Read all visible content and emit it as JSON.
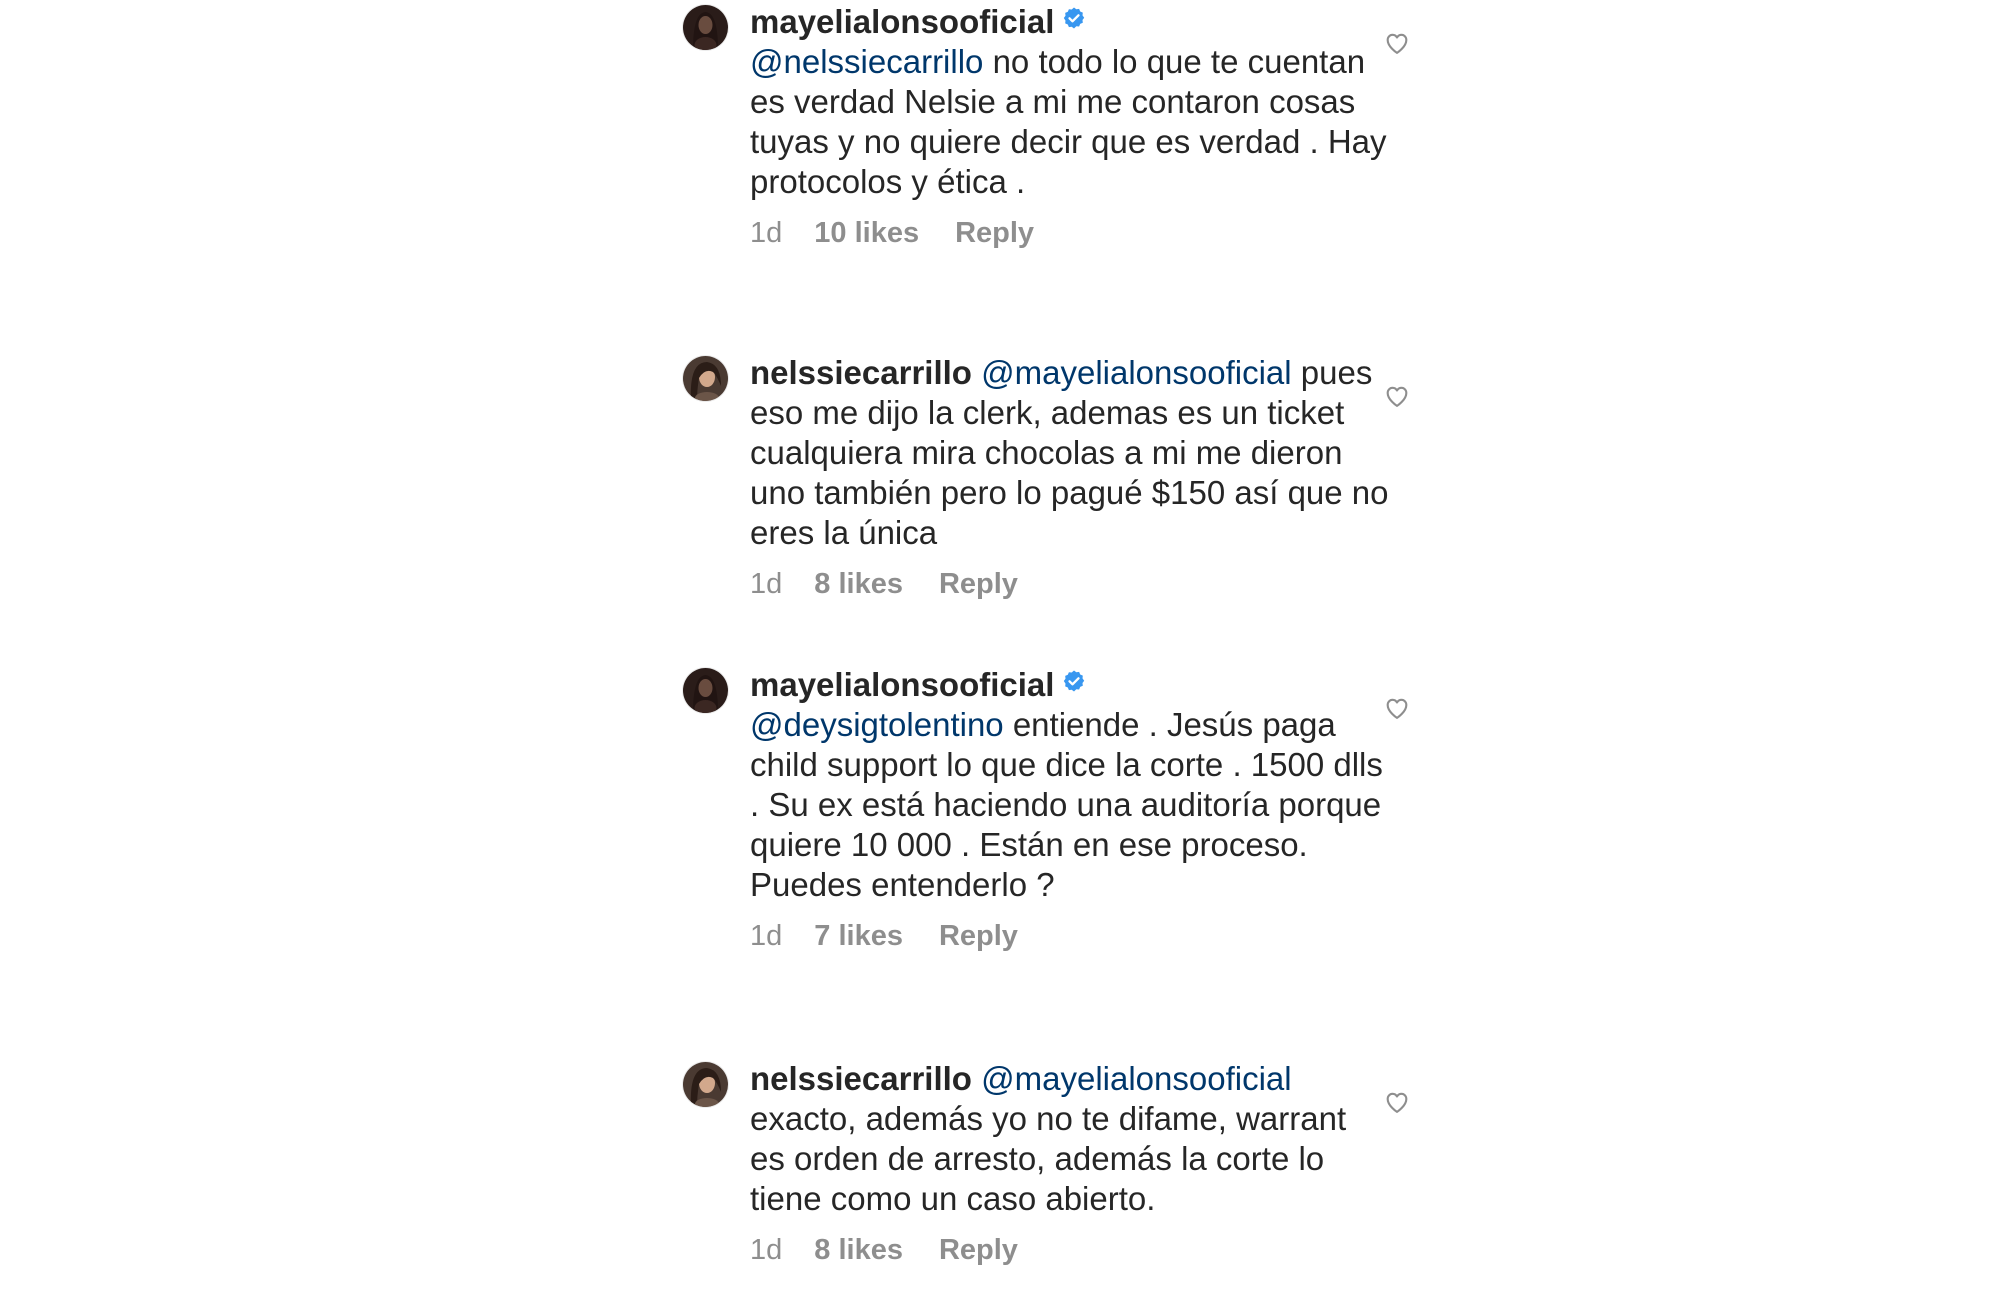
{
  "comments": [
    {
      "username": "mayelialonsooficial",
      "verified": true,
      "mention": "@nelssiecarrillo",
      "text": " no todo lo que te cuentan es verdad Nelsie a mi me contaron cosas tuyas y no quiere decir que es verdad . Hay protocolos y ética .",
      "time": "1d",
      "likes": "10 likes",
      "reply": "Reply"
    },
    {
      "username": "nelssiecarrillo",
      "verified": false,
      "mention": "@mayelialonsooficial",
      "text": " pues eso me dijo la clerk, ademas es un ticket cualquiera mira chocolas a mi me dieron uno también pero lo pagué $150 así que no eres la única",
      "time": "1d",
      "likes": "8 likes",
      "reply": "Reply"
    },
    {
      "username": "mayelialonsooficial",
      "verified": true,
      "mention": "@deysigtolentino",
      "text": " entiende . Jesús paga child support lo que dice la corte . 1500 dlls . Su ex está haciendo una auditoría porque quiere 10 000 . Están en ese proceso. Puedes entenderlo ?",
      "time": "1d",
      "likes": "7 likes",
      "reply": "Reply"
    },
    {
      "username": "nelssiecarrillo",
      "verified": false,
      "mention": "@mayelialonsooficial",
      "text": " exacto, además yo no te difame, warrant es orden de arresto, además la corte lo tiene como un caso abierto.",
      "time": "1d",
      "likes": "8 likes",
      "reply": "Reply"
    }
  ],
  "icons": {
    "verified": "verified-badge-icon",
    "like": "heart-outline-icon"
  },
  "colors": {
    "text": "#262626",
    "mention": "#00376b",
    "meta": "#8e8e8e",
    "verified": "#3897f0"
  }
}
